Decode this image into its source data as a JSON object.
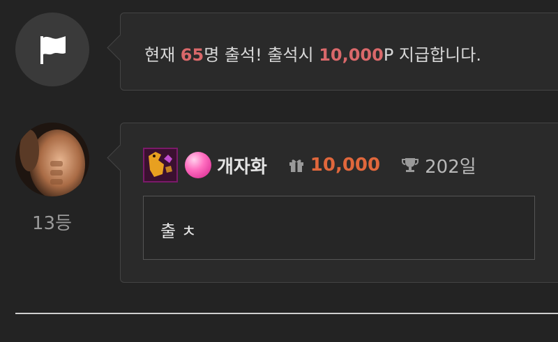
{
  "notice": {
    "prefix": "현재 ",
    "count": "65",
    "mid": "명 출석! 출석시 ",
    "reward": "10,000",
    "suffix": "P 지급합니다."
  },
  "comment": {
    "nickname": "개자화",
    "points": "10,000",
    "days": "202일",
    "text": "출 ㅊ",
    "rank": "13등"
  },
  "colors": {
    "background": "#232323",
    "highlight": "#d9686a",
    "points": "#e0673c",
    "level_badge_border": "#7b1a6a"
  },
  "icons": {
    "notice_avatar": "flag-icon",
    "points": "gift-icon",
    "days": "trophy-icon"
  }
}
